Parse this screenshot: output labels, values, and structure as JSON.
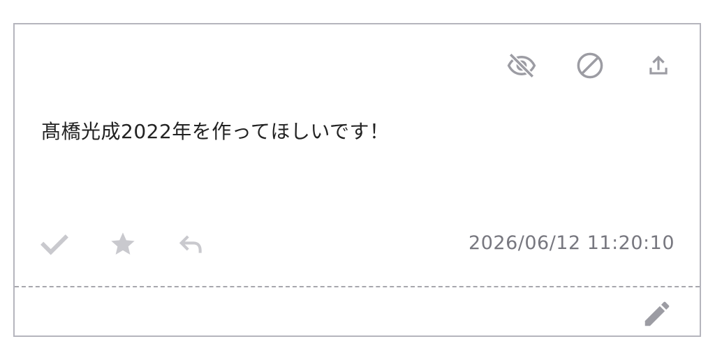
{
  "post": {
    "message": "髙橋光成2022年を作ってほしいです！",
    "timestamp": "2026/06/12 11:20:10"
  },
  "icons": {
    "top": [
      "eye-off-icon",
      "block-icon",
      "upload-icon"
    ],
    "bottom": [
      "check-icon",
      "star-icon",
      "reply-icon"
    ],
    "footer": "pencil-icon"
  },
  "colors": {
    "icon_dark": "#9c9ca3",
    "icon_light": "#c9c9ce",
    "text": "#222222",
    "timestamp": "#77777f",
    "border": "#b5b5bd"
  }
}
